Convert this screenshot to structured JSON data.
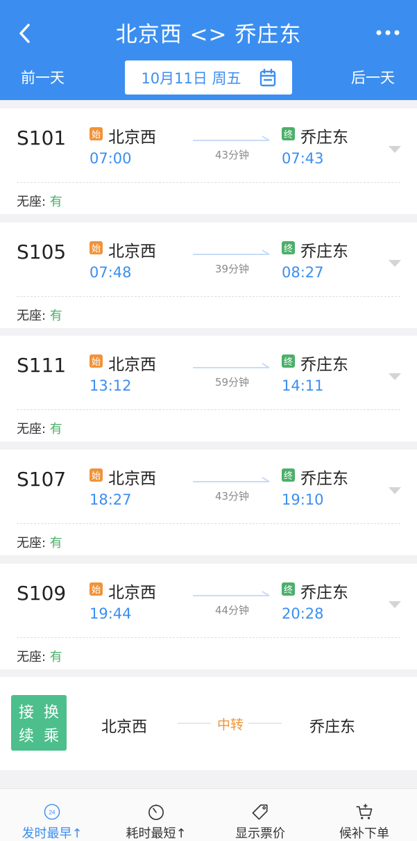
{
  "header": {
    "title": "北京西 <> 乔庄东",
    "prev_day": "前一天",
    "next_day": "后一天",
    "date": "10月11日 周五"
  },
  "trains": [
    {
      "train_no": "S101",
      "start_badge": "始",
      "from": "北京西",
      "dep_time": "07:00",
      "duration": "43分钟",
      "end_badge": "终",
      "to": "乔庄东",
      "arr_time": "07:43",
      "seat_label": "无座: ",
      "seat_status": "有"
    },
    {
      "train_no": "S105",
      "start_badge": "始",
      "from": "北京西",
      "dep_time": "07:48",
      "duration": "39分钟",
      "end_badge": "终",
      "to": "乔庄东",
      "arr_time": "08:27",
      "seat_label": "无座: ",
      "seat_status": "有"
    },
    {
      "train_no": "S111",
      "start_badge": "始",
      "from": "北京西",
      "dep_time": "13:12",
      "duration": "59分钟",
      "end_badge": "终",
      "to": "乔庄东",
      "arr_time": "14:11",
      "seat_label": "无座: ",
      "seat_status": "有"
    },
    {
      "train_no": "S107",
      "start_badge": "始",
      "from": "北京西",
      "dep_time": "18:27",
      "duration": "43分钟",
      "end_badge": "终",
      "to": "乔庄东",
      "arr_time": "19:10",
      "seat_label": "无座: ",
      "seat_status": "有"
    },
    {
      "train_no": "S109",
      "start_badge": "始",
      "from": "北京西",
      "dep_time": "19:44",
      "duration": "44分钟",
      "end_badge": "终",
      "to": "乔庄东",
      "arr_time": "20:28",
      "seat_label": "无座: ",
      "seat_status": "有"
    }
  ],
  "transfer": {
    "tag_chars": [
      "接",
      "换",
      "续",
      "乘"
    ],
    "from": "北京西",
    "middle": "中转",
    "to": "乔庄东"
  },
  "bottom_tabs": [
    {
      "label": "发时最早↑",
      "icon": "clock-24-icon",
      "icon_text": "24",
      "active": true
    },
    {
      "label": "耗时最短↑",
      "icon": "timer-icon",
      "active": false
    },
    {
      "label": "显示票价",
      "icon": "price-tag-icon",
      "active": false
    },
    {
      "label": "候补下单",
      "icon": "cart-add-icon",
      "active": false
    }
  ],
  "colors": {
    "primary": "#3b8ef0",
    "start_badge": "#f0933a",
    "end_badge": "#4caf6a",
    "available": "#4caf6a",
    "transfer_tag": "#4cbf8c"
  }
}
